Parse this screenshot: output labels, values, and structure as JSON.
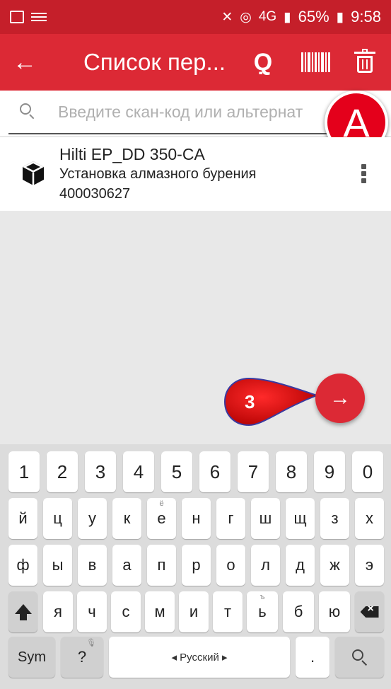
{
  "status_bar": {
    "battery": "65%",
    "time": "9:58",
    "network": "4G"
  },
  "app_bar": {
    "title": "Список пер...",
    "icons": [
      "back-arrow-icon",
      "zoom-add-icon",
      "barcode-icon",
      "trash-icon"
    ]
  },
  "search": {
    "placeholder": "Введите скан-код или альтернат"
  },
  "annotations": {
    "marker_a": "A",
    "marker_3": "3"
  },
  "list": {
    "items": [
      {
        "name": "Hilti EP_DD 350-CA",
        "description": "Установка алмазного бурения",
        "number": "400030627"
      }
    ]
  },
  "fab": {
    "icon": "arrow-right-icon",
    "glyph": "→"
  },
  "keyboard": {
    "number_row": [
      "1",
      "2",
      "3",
      "4",
      "5",
      "6",
      "7",
      "8",
      "9",
      "0"
    ],
    "row1": [
      "й",
      "ц",
      "у",
      "к",
      "е",
      "н",
      "г",
      "ш",
      "щ",
      "з",
      "х"
    ],
    "row1_hint_e": "ё",
    "row2": [
      "ф",
      "ы",
      "в",
      "а",
      "п",
      "р",
      "о",
      "л",
      "д",
      "ж",
      "э"
    ],
    "row3": [
      "я",
      "ч",
      "с",
      "м",
      "и",
      "т",
      "ь",
      "б",
      "ю"
    ],
    "row3_hint_soft": "ъ",
    "sym_label": "Sym",
    "question_label": "?",
    "space_label": "◂ Русский ▸",
    "period_label": "."
  }
}
